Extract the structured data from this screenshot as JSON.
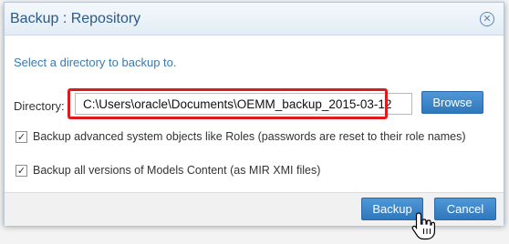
{
  "dialog": {
    "title": "Backup : Repository",
    "close_icon": "close-circle-icon",
    "prompt": "Select a directory to backup to.",
    "directory_label": "Directory:",
    "directory_value": "C:\\Users\\oracle\\Documents\\OEMM_backup_2015-03-12",
    "browse_label": "Browse",
    "options": [
      {
        "label": "Backup advanced system objects like Roles (passwords are reset to their role names)",
        "checked": true
      },
      {
        "label": "Backup all versions of Models Content (as MIR XMI files)",
        "checked": true
      }
    ],
    "backup_label": "Backup",
    "cancel_label": "Cancel"
  },
  "colors": {
    "accent": "#3a7ab0",
    "button": "#2f78bd",
    "highlight": "#e01a1a"
  },
  "cursor_icon": "hand-pointer-icon"
}
